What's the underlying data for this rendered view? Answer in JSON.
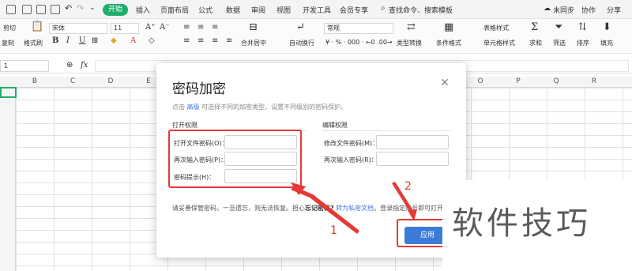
{
  "menubar": {
    "start_tab": "开始",
    "tabs": [
      "插入",
      "页面布局",
      "公式",
      "数据",
      "审阅",
      "视图",
      "开发工具",
      "会员专享"
    ],
    "search_placeholder": "查找命令、搜索模板",
    "sync": "未同步",
    "collab": "协作",
    "share": "分享"
  },
  "ribbon": {
    "cut": "剪切",
    "paste": "粘贴",
    "copy": "复制",
    "format_painter": "格式刷",
    "font_name": "宋体",
    "font_size": "11",
    "bold": "B",
    "italic": "I",
    "underline": "U",
    "merge": "合并居中",
    "wrap": "自动换行",
    "number_format": "常规",
    "type_convert": "类型转换",
    "cond_format": "条件格式",
    "table_style": "表格样式",
    "cell_style": "单元格样式",
    "sum": "求和",
    "filter": "筛选",
    "sort": "排序",
    "fill": "填充"
  },
  "formulabar": {
    "namebox": "1",
    "fx": "fx"
  },
  "grid": {
    "columns": [
      "B",
      "C",
      "D",
      "E",
      "",
      "",
      "",
      "",
      "",
      "O",
      "P",
      "Q",
      "R"
    ]
  },
  "dialog": {
    "title": "密码加密",
    "hint_prefix": "点击",
    "hint_link": "高级",
    "hint_suffix": "可选择不同的加密类型，设置不同级别的密码保护。",
    "open_section": "打开权限",
    "edit_section": "编辑权限",
    "open_password_label": "打开文件密码(O)：",
    "open_confirm_label": "再次输入密码(P)：",
    "password_hint_label": "密码提示(H)：",
    "modify_password_label": "修改文件密码(M)：",
    "modify_confirm_label": "再次输入密码(R)：",
    "warn_prefix": "请妥善保管密码，一旦遗忘，则无法恢复。担心",
    "warn_bold": "忘记密码?",
    "warn_link": "转为私密文档",
    "warn_suffix": "，登录指定账号即可打开。",
    "apply": "应用"
  },
  "annotations": {
    "step1": "1",
    "step2": "2"
  },
  "watermark": "软件技巧",
  "colors": {
    "accent_green": "#1eae6b",
    "button_blue": "#3d7bd8",
    "annotation_red": "#e53935"
  }
}
